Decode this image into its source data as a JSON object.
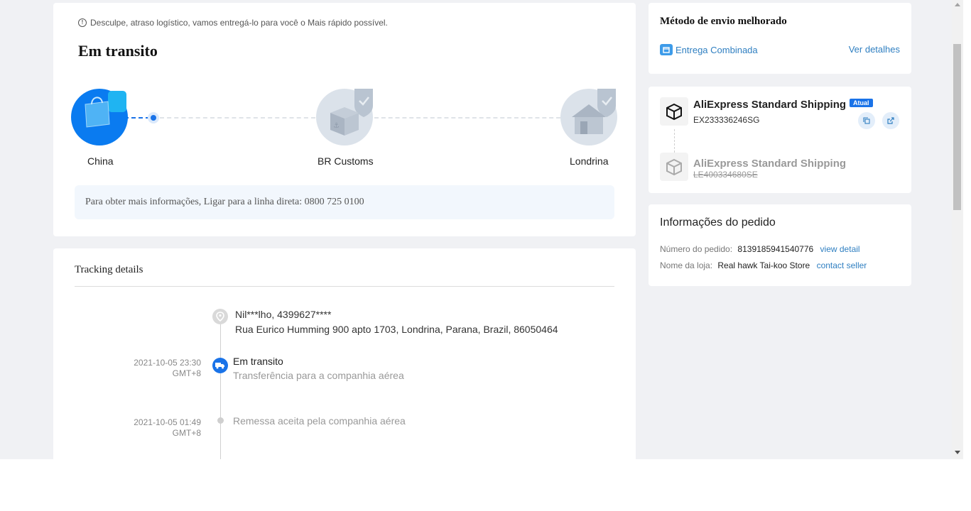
{
  "status": {
    "notice": "Desculpe, atraso logístico, vamos entregá-lo para você o Mais rápido possível.",
    "title": "Em transito",
    "route": [
      {
        "label": "China",
        "icon": "shopping-bag-icon",
        "state": "current"
      },
      {
        "label": "BR Customs",
        "icon": "customs-package-icon",
        "state": "pending"
      },
      {
        "label": "Londrina",
        "icon": "house-icon",
        "state": "pending"
      }
    ],
    "hotline": "Para obter mais informações, Ligar para a linha direta: 0800 725 0100"
  },
  "tracking": {
    "heading": "Tracking details",
    "recipient": {
      "name_phone": "Nil***lho,  4399627****",
      "address": "Rua Eurico Humming 900 apto 1703,  Londrina,  Parana,  Brazil,  86050464"
    },
    "events": [
      {
        "date": "2021-10-05 23:30",
        "tz": "GMT+8",
        "title": "Em transito",
        "desc": "Transferência para a companhia aérea"
      },
      {
        "date": "2021-10-05 01:49",
        "tz": "GMT+8",
        "title": "",
        "desc": "Remessa aceita pela companhia aérea"
      }
    ]
  },
  "improved_shipping": {
    "title": "Método de envio melhorado",
    "combined_label": "Entrega Combinada",
    "details_link": "Ver detalhes"
  },
  "shipping_methods": [
    {
      "name": "AliExpress Standard Shipping",
      "code": "EX233336246SG",
      "badge": "Atual",
      "active": true
    },
    {
      "name": "AliExpress Standard Shipping",
      "code": "LE400334680SE",
      "active": false
    }
  ],
  "order_info": {
    "title": "Informações do pedido",
    "order_number_label": "Número do pedido:",
    "order_number": "8139185941540776",
    "view_detail": "view detail",
    "store_label": "Nome da loja:",
    "store_name": "Real hawk Tai-koo Store",
    "contact_seller": "contact seller"
  },
  "colors": {
    "accent": "#1a73e8",
    "link": "#2f7fc1",
    "page_bg": "#f0f1f4",
    "hotline_bg": "#f2f7fd"
  }
}
